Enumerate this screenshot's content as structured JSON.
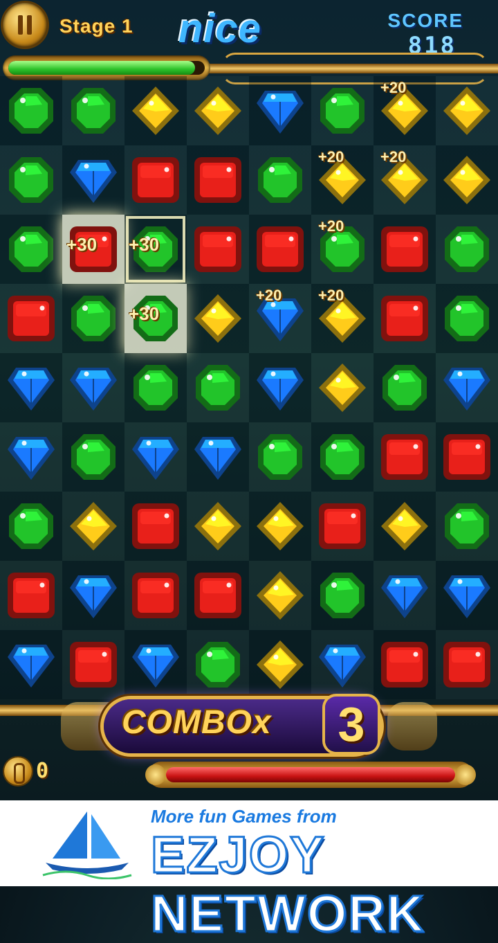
{
  "hud": {
    "stage_label": "Stage 1",
    "praise": "nice",
    "score_title": "SCORE",
    "score_value": "818",
    "time_fraction": 0.95,
    "coins": "0",
    "power_fraction": 1.0
  },
  "board": {
    "cols": 8,
    "rows": 9,
    "gems": [
      [
        "green",
        "green",
        "yellow",
        "yellow",
        "blue",
        "green",
        "yellow",
        "yellow"
      ],
      [
        "green",
        "blue",
        "red",
        "red",
        "green",
        "yellow",
        "yellow",
        "yellow"
      ],
      [
        "green",
        "red",
        "green",
        "red",
        "red",
        "green",
        "red",
        "green"
      ],
      [
        "red",
        "green",
        "green",
        "yellow",
        "blue",
        "yellow",
        "red",
        "green"
      ],
      [
        "blue",
        "blue",
        "green",
        "green",
        "blue",
        "yellow",
        "green",
        "blue"
      ],
      [
        "blue",
        "green",
        "blue",
        "blue",
        "green",
        "green",
        "red",
        "red"
      ],
      [
        "green",
        "yellow",
        "red",
        "yellow",
        "yellow",
        "red",
        "yellow",
        "green"
      ],
      [
        "red",
        "blue",
        "red",
        "red",
        "yellow",
        "green",
        "blue",
        "blue"
      ],
      [
        "blue",
        "red",
        "blue",
        "green",
        "yellow",
        "blue",
        "red",
        "red"
      ]
    ],
    "highlighted_cells": [
      [
        2,
        1
      ],
      [
        2,
        2
      ],
      [
        3,
        2
      ]
    ],
    "bonuses": [
      {
        "text": "+20",
        "row": 0,
        "col": 6
      },
      {
        "text": "+20",
        "row": 1,
        "col": 5
      },
      {
        "text": "+20",
        "row": 1,
        "col": 6
      },
      {
        "text": "+20",
        "row": 2,
        "col": 5
      },
      {
        "text": "+30",
        "row": 2,
        "col": 1
      },
      {
        "text": "+30",
        "row": 2,
        "col": 2
      },
      {
        "text": "+20",
        "row": 3,
        "col": 4
      },
      {
        "text": "+20",
        "row": 3,
        "col": 5
      },
      {
        "text": "+30",
        "row": 3,
        "col": 2
      }
    ]
  },
  "combo": {
    "label": "COMBOx",
    "count": "3",
    "ghost_left": "C",
    "ghost_right": "3"
  },
  "ad": {
    "tagline": "More fun Games from",
    "brand": "EZJOY NETWORK"
  },
  "colors": {
    "green": "#22c42a",
    "yellow": "#ffcc1a",
    "blue": "#1a7aff",
    "red": "#e8201a"
  },
  "icons": {
    "pause": "pause-icon",
    "coin": "coin-icon",
    "sailboat": "sailboat-icon"
  }
}
